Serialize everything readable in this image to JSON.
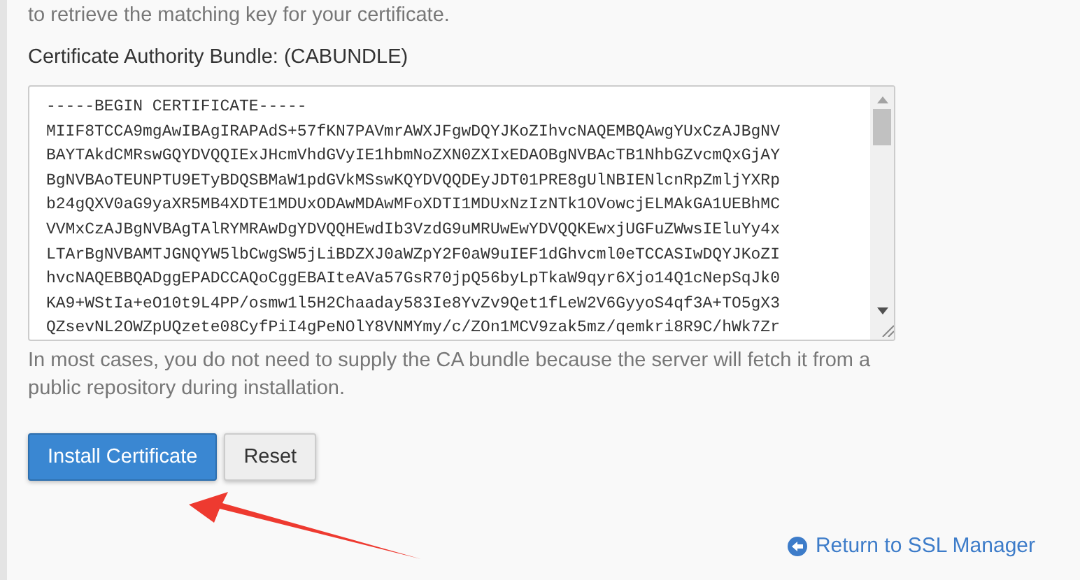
{
  "intro_text": "to retrieve the matching key for your certificate.",
  "cabundle": {
    "label": "Certificate Authority Bundle: (CABUNDLE)",
    "lines": [
      "-----BEGIN CERTIFICATE-----",
      "MIIF8TCCA9mgAwIBAgIRAPAdS+57fKN7PAVmrAWXJFgwDQYJKoZIhvcNAQEMBQAwgYUxCzAJBgNV",
      "BAYTAkdCMRswGQYDVQQIExJHcmVhdGVyIE1hbmNoZXN0ZXIxEDAOBgNVBAcTB1NhbGZvcmQxGjAY",
      "BgNVBAoTEUNPTU9ETyBDQSBMaW1pdGVkMSswKQYDVQQDEyJDT01PRE8gUlNBIENlcnRpZmljYXRp",
      "b24gQXV0aG9yaXR5MB4XDTE1MDUxODAwMDAwMFoXDTI1MDUxNzIzNTk1OVowcjELMAkGA1UEBhMC",
      "VVMxCzAJBgNVBAgTAlRYMRAwDgYDVQQHEwdIb3VzdG9uMRUwEwYDVQQKEwxjUGFuZWwsIEluYy4x",
      "LTArBgNVBAMTJGNQYW5lbCwgSW5jLiBDZXJ0aWZpY2F0aW9uIEF1dGhvcml0eTCCASIwDQYJKoZI",
      "hvcNAQEBBQADggEPADCCAQoCggEBAIteAVa57GsR70jpQ56byLpTkaW9qyr6Xjo14Q1cNepSqJk0",
      "KA9+WStIa+eO10t9L4PP/osmw1l5H2Chaaday583Ie8YvZv9Qet1fLeW2V6GyyoS4qf3A+TO5gX3",
      "QZsevNL2OWZpUQzete08CyfPiI4gPeNOlY8VNMYmy/c/ZOn1MCV9zak5mz/qemkri8R9C/hWk7Zr"
    ],
    "help_text": "In most cases, you do not need to supply the CA bundle because the server will fetch it from a public repository during installation."
  },
  "buttons": [
    {
      "label": "Install Certificate",
      "kind": "primary"
    },
    {
      "label": "Reset",
      "kind": "default"
    }
  ],
  "return_link": "Return to SSL Manager"
}
